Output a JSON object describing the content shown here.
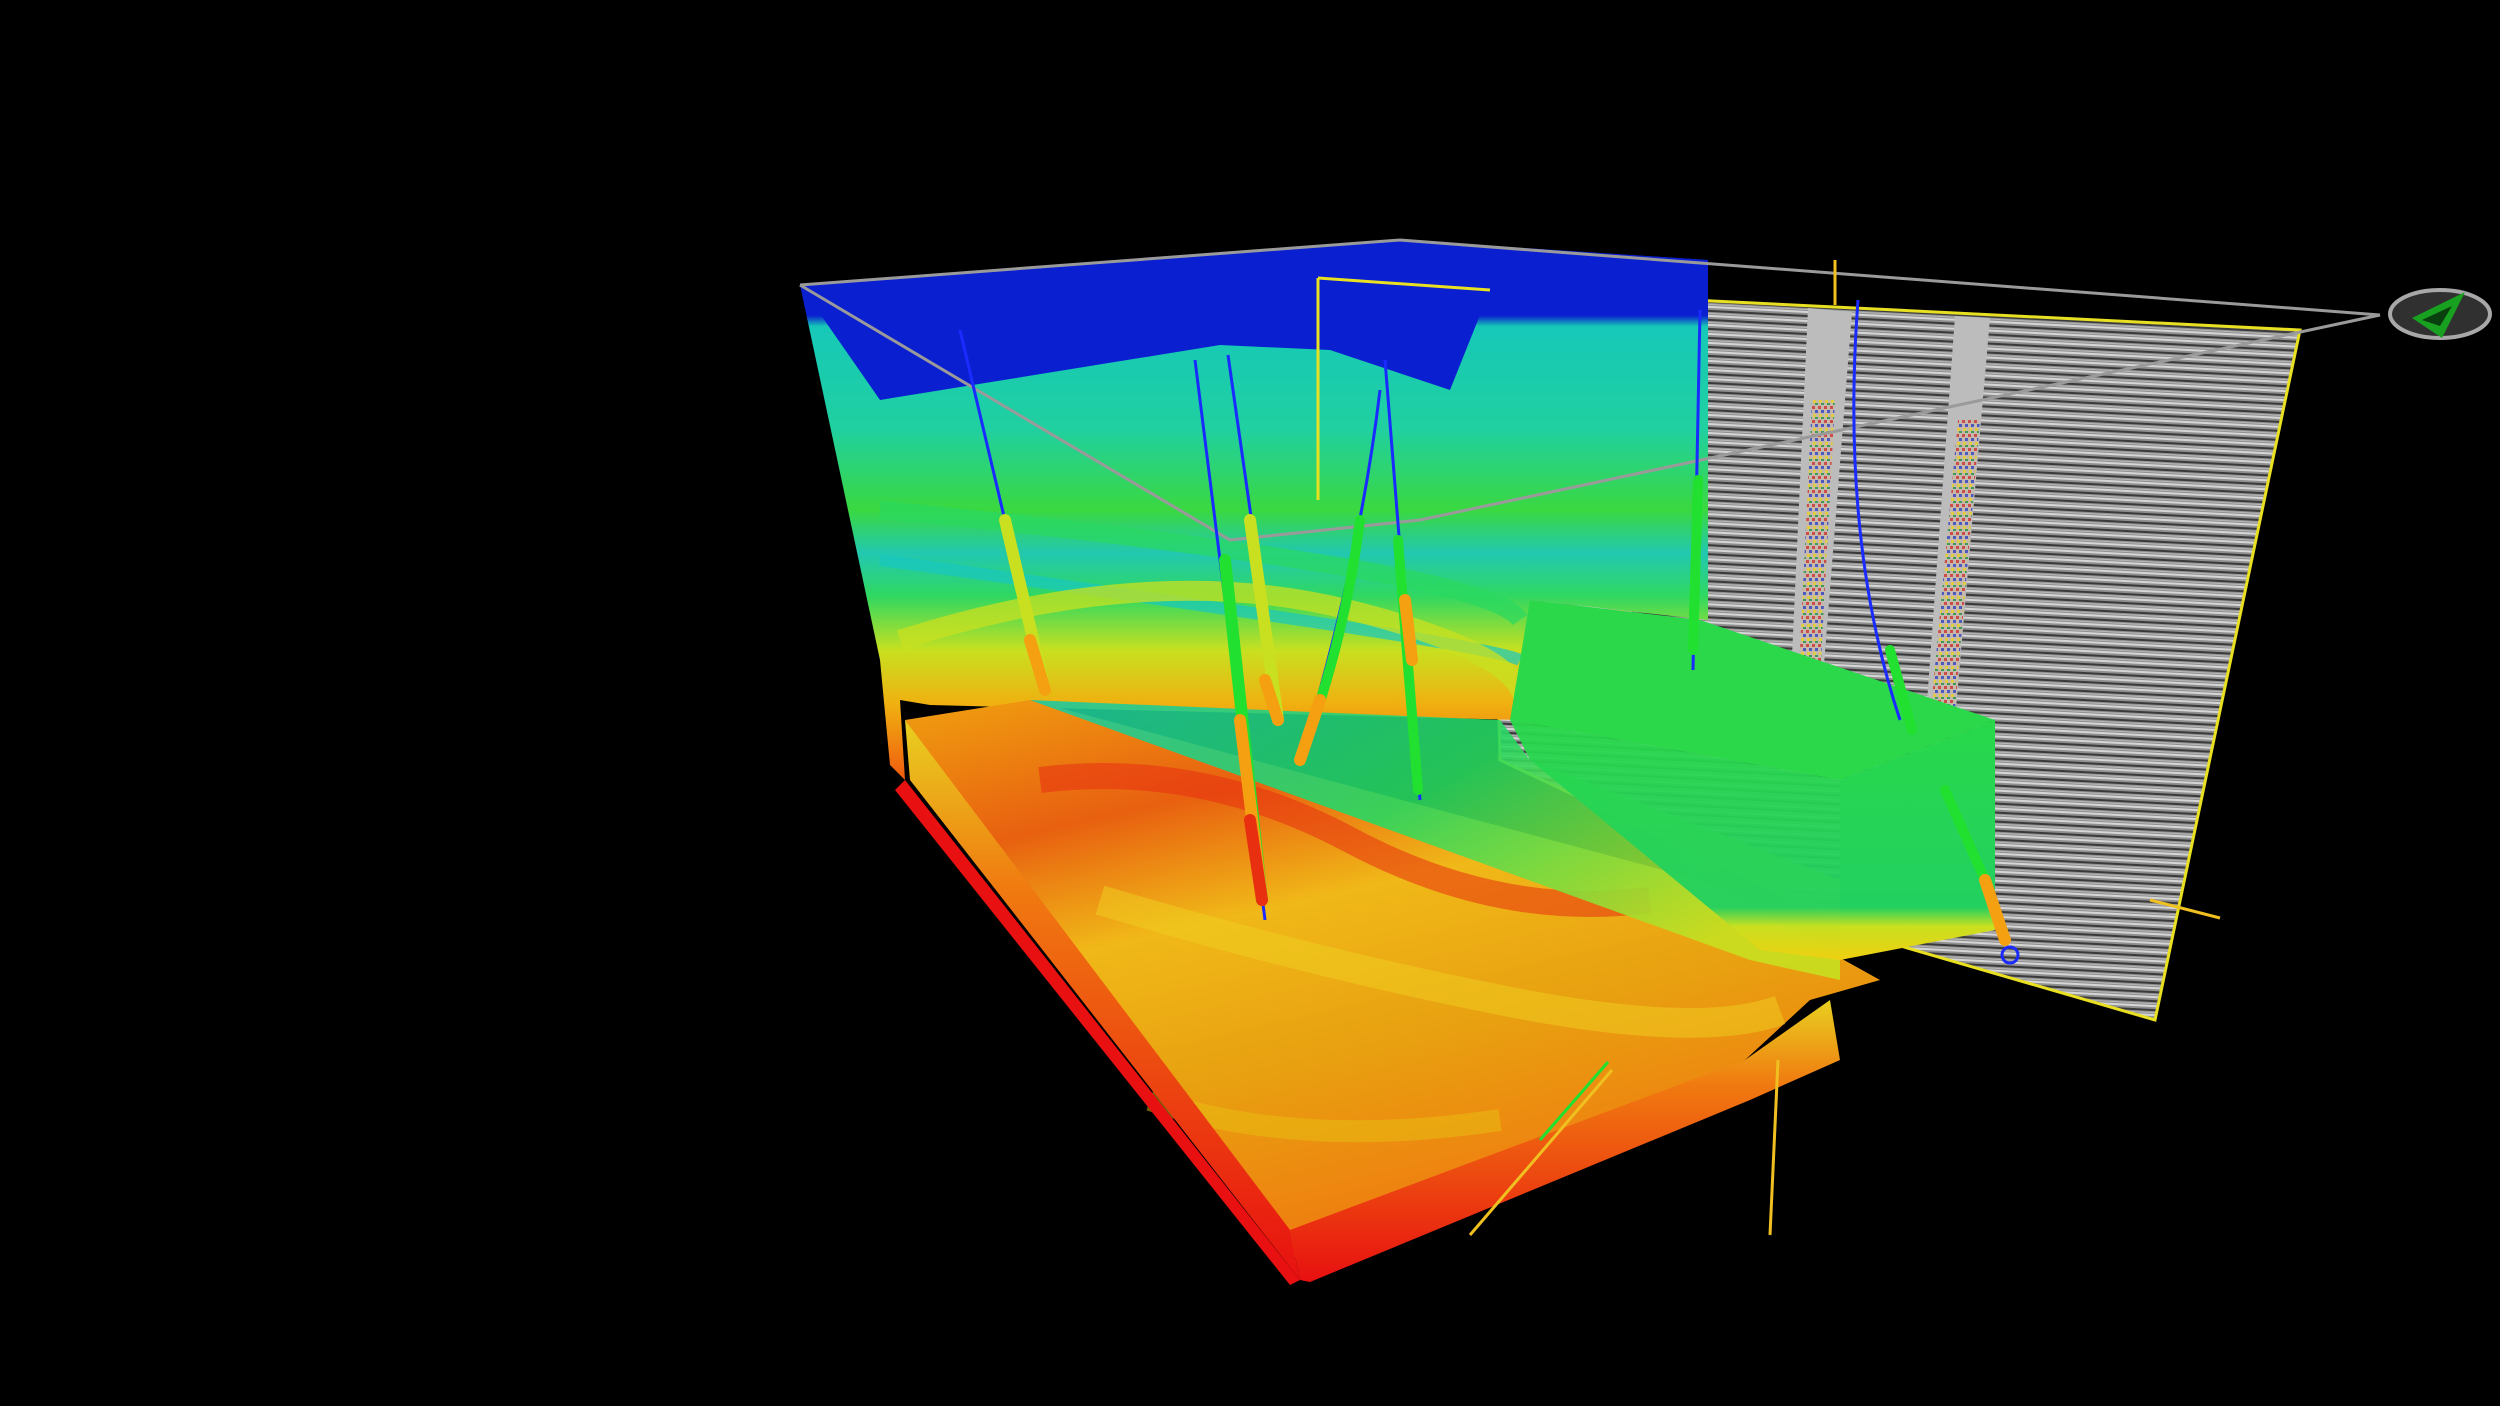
{
  "viewer": {
    "background": "#000000"
  },
  "model": {
    "property_colormap": [
      "#0a20d0",
      "#16c8b8",
      "#22d860",
      "#c8e020",
      "#f0b010",
      "#f05a10",
      "#e81010"
    ],
    "seismic_colors": {
      "base": "#8f8f8f",
      "dark_reflector": "#3a3a3a",
      "light_reflector": "#d6d6d6"
    },
    "wells": {
      "trajectory_color": "#1a2bff",
      "log_colors": [
        "#22e030",
        "#c8e020",
        "#f5a010",
        "#e83010"
      ]
    },
    "outline_colors": {
      "frame": "#9a9a9a",
      "seismic_edge": "#e8e020",
      "axis_line": "#f0c020"
    }
  },
  "compass": {
    "icon": "north-arrow-compass-icon",
    "ring_color": "#a8a8a8",
    "arrow_color": "#18a020"
  }
}
